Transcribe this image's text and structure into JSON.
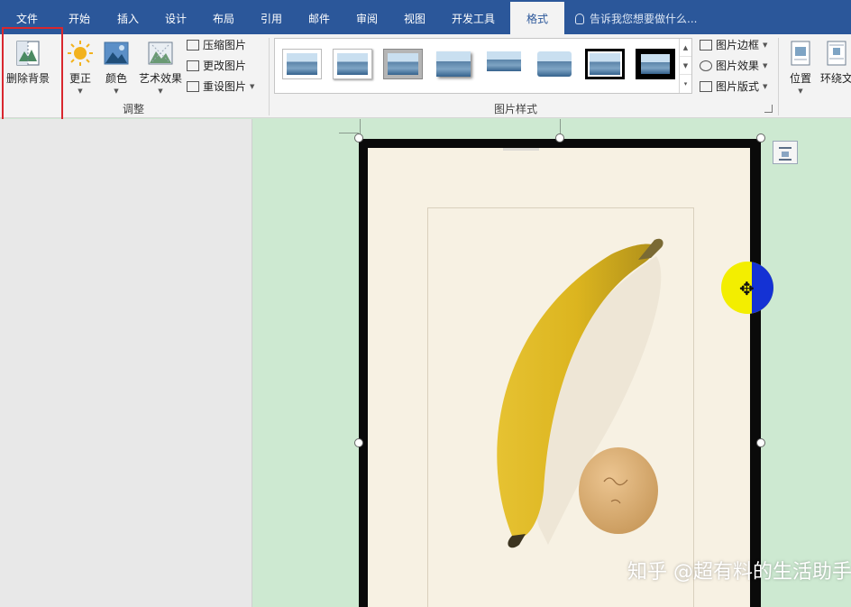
{
  "tabs": [
    {
      "label": "文件"
    },
    {
      "label": "开始"
    },
    {
      "label": "插入"
    },
    {
      "label": "设计"
    },
    {
      "label": "布局"
    },
    {
      "label": "引用"
    },
    {
      "label": "邮件"
    },
    {
      "label": "审阅"
    },
    {
      "label": "视图"
    },
    {
      "label": "开发工具"
    },
    {
      "label": "格式"
    }
  ],
  "active_tab": "格式",
  "tell_me": "告诉我您想要做什么...",
  "adjust_group": {
    "label": "调整",
    "remove_background": "删除背景",
    "corrections": "更正",
    "color": "颜色",
    "artistic_effects": "艺术效果",
    "compress_pictures": "压缩图片",
    "change_picture": "更改图片",
    "reset_picture": "重设图片"
  },
  "styles_group": {
    "label": "图片样式",
    "picture_border": "图片边框",
    "picture_effects": "图片效果",
    "picture_layout": "图片版式"
  },
  "arrange_group": {
    "position": "位置",
    "wrap_text": "环绕文"
  },
  "watermark": "知乎 @超有料的生活助手",
  "colors": {
    "accent": "#2b579a",
    "highlight": "#d9272e",
    "page_bg": "#cde9d1"
  }
}
